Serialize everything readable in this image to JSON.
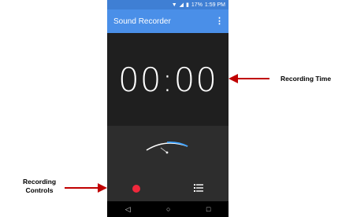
{
  "status_bar": {
    "battery": "17%",
    "time": "1:59 PM"
  },
  "app_bar": {
    "title": "Sound Recorder",
    "overflow_glyph": "⋮"
  },
  "timer": {
    "value": "00:00"
  },
  "nav": {
    "back": "◁",
    "home": "○",
    "recent": "□"
  },
  "annotations": {
    "recording_time": "Recording Time",
    "recording_controls_line1": "Recording",
    "recording_controls_line2": "Controls"
  },
  "colors": {
    "accent": "#4a8fe8",
    "record": "#f0283c",
    "arrow": "#c00000",
    "gauge_blue": "#3aa0ff"
  }
}
